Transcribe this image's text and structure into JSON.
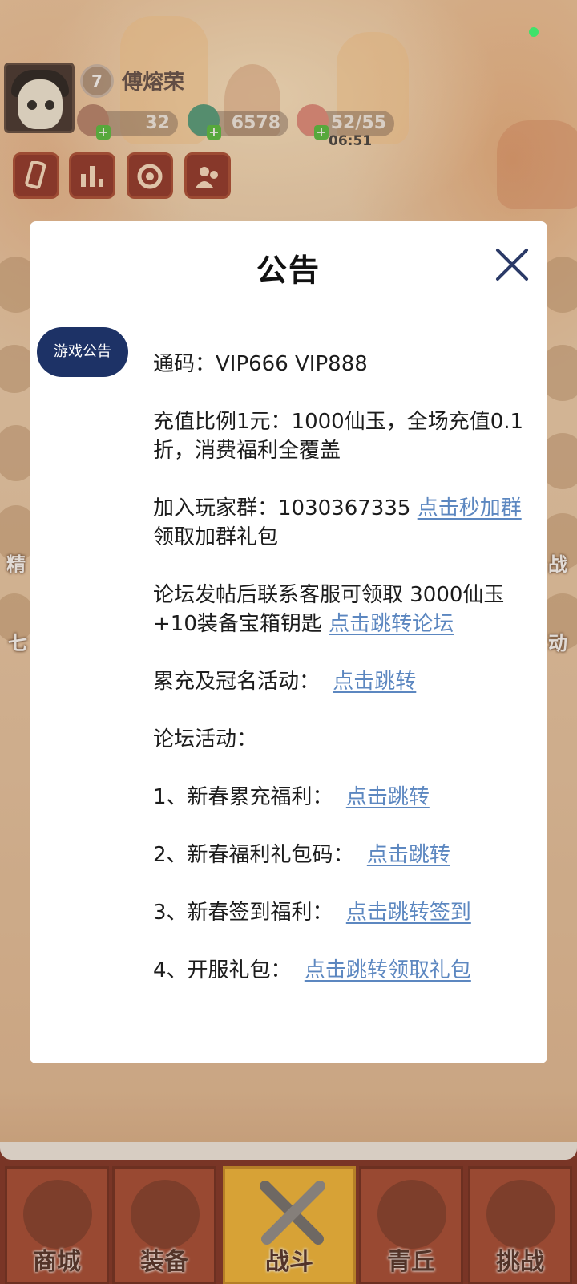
{
  "hud": {
    "level": "7",
    "player_name": "傅熔荣",
    "resource_1": "32",
    "resource_2": "6578",
    "stamina": "52/55",
    "stamina_timer": "06:51"
  },
  "side_labels": {
    "left_1": "精",
    "left_2": "七",
    "right_1": "战",
    "right_2": "动"
  },
  "bottom_nav": {
    "tabs": [
      {
        "label": "商城"
      },
      {
        "label": "装备"
      },
      {
        "label": "战斗"
      },
      {
        "label": "青丘"
      },
      {
        "label": "挑战"
      }
    ],
    "active_index": 2
  },
  "modal": {
    "title": "公告",
    "tab_label": "游戏公告",
    "lines": {
      "code": "通码：VIP666 VIP888",
      "recharge": "充值比例1元：1000仙玉，全场充值0.1折，消费福利全覆盖",
      "group_text": "加入玩家群：1030367335 ",
      "group_link": "点击秒加群",
      "group_text_2": "领取加群礼包",
      "forum_text": "论坛发帖后联系客服可领取 3000仙玉+10装备宝箱钥匙 ",
      "forum_link": "点击跳转论坛",
      "cumulative_text": "累充及冠名活动：",
      "cumulative_link": "点击跳转",
      "forum_activity_text": "论坛活动：",
      "item1_text": "1、新春累充福利：",
      "item1_link": "点击跳转",
      "item2_text": "2、新春福利礼包码：",
      "item2_link": "点击跳转",
      "item3_text": "3、新春签到福利：",
      "item3_link": "点击跳转签到",
      "item4_text": "4、开服礼包：",
      "item4_link": "点击跳转领取礼包"
    }
  },
  "colors": {
    "tab_pill": "#1d3266",
    "link": "#5c87c0",
    "close_icon": "#2b3a67"
  }
}
